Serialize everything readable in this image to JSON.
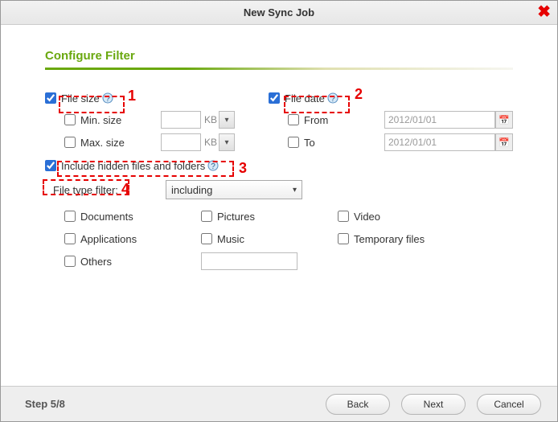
{
  "window": {
    "title": "New Sync Job"
  },
  "section": {
    "title": "Configure Filter"
  },
  "filesize": {
    "label": "File size",
    "min_label": "Min. size",
    "max_label": "Max. size",
    "unit": "KB"
  },
  "filedate": {
    "label": "File date",
    "from_label": "From",
    "to_label": "To",
    "from_value": "2012/01/01",
    "to_value": "2012/01/01"
  },
  "hidden": {
    "label": "Include hidden files and folders"
  },
  "filetype": {
    "label": "File type filter:",
    "select_value": "including",
    "options": {
      "documents": "Documents",
      "pictures": "Pictures",
      "video": "Video",
      "applications": "Applications",
      "music": "Music",
      "temp": "Temporary files",
      "others": "Others"
    }
  },
  "footer": {
    "step": "Step 5/8",
    "back": "Back",
    "next": "Next",
    "cancel": "Cancel"
  },
  "annotations": {
    "n1": "1",
    "n2": "2",
    "n3": "3",
    "n4": "4"
  }
}
